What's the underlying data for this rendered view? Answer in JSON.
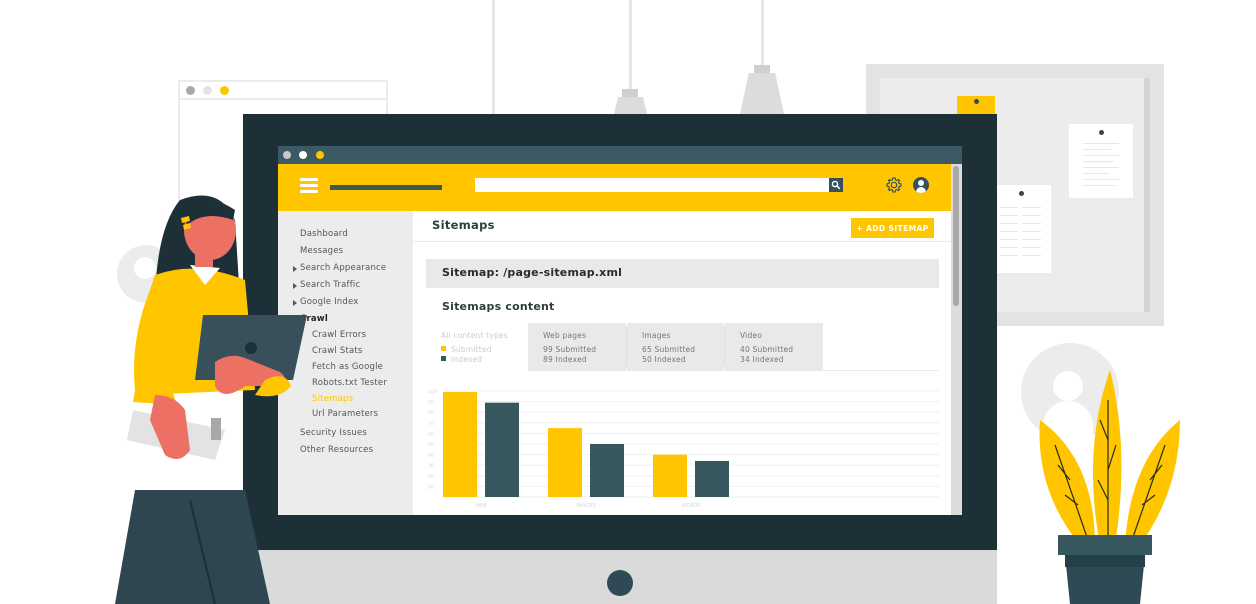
{
  "window": {
    "titlebar_dots": [
      "#c9c9c9",
      "#ffffff",
      "#ffc600"
    ]
  },
  "header": {
    "search": {
      "value": "",
      "placeholder": ""
    },
    "search_icon": "search-icon",
    "settings_icon": "gear-icon",
    "account_icon": "user-avatar-icon"
  },
  "sidebar": {
    "items": [
      {
        "label": "Dashboard",
        "level": 0,
        "expandable": false,
        "state": "normal"
      },
      {
        "label": "Messages",
        "level": 0,
        "expandable": false,
        "state": "normal"
      },
      {
        "label": "Search Appearance",
        "level": 0,
        "expandable": true,
        "state": "normal"
      },
      {
        "label": "Search Traffic",
        "level": 0,
        "expandable": true,
        "state": "normal"
      },
      {
        "label": "Google Index",
        "level": 0,
        "expandable": true,
        "state": "normal"
      },
      {
        "label": "Crawl",
        "level": 0,
        "expandable": false,
        "state": "section"
      },
      {
        "label": "Crawl Errors",
        "level": 1,
        "expandable": false,
        "state": "normal"
      },
      {
        "label": "Crawl Stats",
        "level": 1,
        "expandable": false,
        "state": "normal"
      },
      {
        "label": "Fetch as Google",
        "level": 1,
        "expandable": false,
        "state": "normal"
      },
      {
        "label": "Robots.txt Tester",
        "level": 1,
        "expandable": false,
        "state": "normal"
      },
      {
        "label": "Sitemaps",
        "level": 1,
        "expandable": false,
        "state": "active"
      },
      {
        "label": "Url Parameters",
        "level": 1,
        "expandable": false,
        "state": "normal"
      },
      {
        "label": "Security Issues",
        "level": 0,
        "expandable": false,
        "state": "normal"
      },
      {
        "label": "Other Resources",
        "level": 0,
        "expandable": false,
        "state": "normal"
      }
    ]
  },
  "main": {
    "title": "Sitemaps",
    "add_button": "+ ADD SITEMAP",
    "sitemap_heading": "Sitemap: /page-sitemap.xml",
    "content_heading": "Sitemaps content",
    "tabs": [
      {
        "label": "All content types",
        "line1": "Submitted",
        "line2": "Indexed"
      },
      {
        "label": "Web pages",
        "line1": "99  Submitted",
        "line2": "89 Indexed"
      },
      {
        "label": "Images",
        "line1": "65  Submitted",
        "line2": "50 Indexed"
      },
      {
        "label": "Video",
        "line1": "40  Submitted",
        "line2": "34 Indexed"
      }
    ]
  },
  "colors": {
    "accent": "#ffc600",
    "indexed": "#37575f",
    "bezel": "#1d2f37",
    "titlebar": "#3b5a64"
  },
  "chart_data": {
    "type": "bar",
    "title": "",
    "categories": [
      "WEB",
      "IMAGES",
      "VIDEOS"
    ],
    "series": [
      {
        "name": "Submitted",
        "color": "#ffc600",
        "values": [
          99,
          65,
          40
        ]
      },
      {
        "name": "Indexed",
        "color": "#37575f",
        "values": [
          89,
          50,
          34
        ]
      }
    ],
    "yticks": [
      10,
      20,
      30,
      40,
      50,
      60,
      70,
      80,
      90,
      100
    ],
    "ylim": [
      0,
      100
    ],
    "xlabel": "",
    "ylabel": "",
    "grid": true,
    "legend": "top-left (in tab)"
  }
}
